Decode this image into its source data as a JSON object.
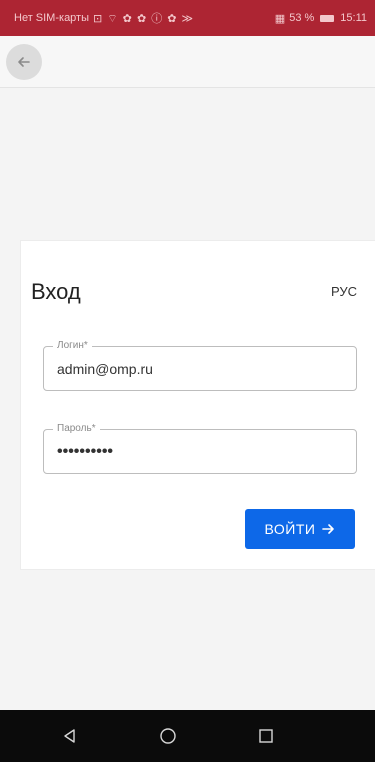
{
  "status_bar": {
    "carrier": "Нет SIM-карты",
    "icons": "⊡ ⌔ ✿ ✿ ⓘ ✿ ≫",
    "battery_percent": "53 %",
    "time": "15:11"
  },
  "app_bar": {
    "back_icon": "arrow-left-icon"
  },
  "login": {
    "title": "Вход",
    "language": "РУС",
    "login_label": "Логин*",
    "login_value": "admin@omp.ru",
    "password_label": "Пароль*",
    "password_value": "••••••••••",
    "submit_label": "ВОЙТИ",
    "submit_icon": "arrow-right-icon",
    "accent_color": "#0d68e8"
  },
  "nav_bar": {
    "back": "triangle-back-icon",
    "home": "circle-home-icon",
    "recents": "square-recents-icon"
  }
}
